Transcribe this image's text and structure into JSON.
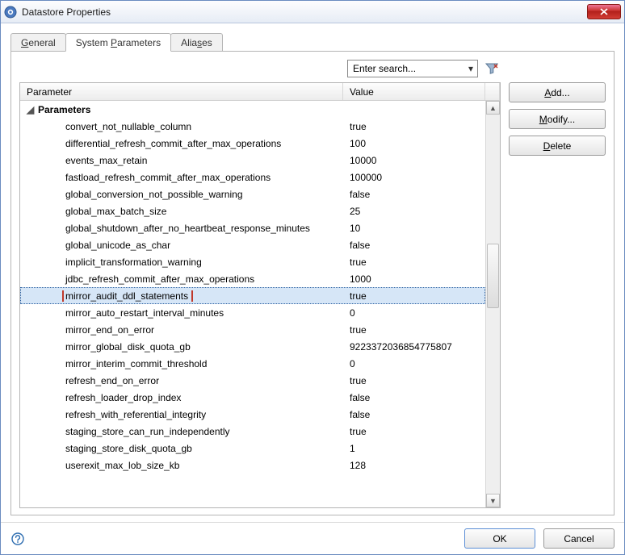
{
  "window": {
    "title": "Datastore Properties"
  },
  "tabs": [
    {
      "label_pre": "",
      "m": "G",
      "label_post": "eneral"
    },
    {
      "label_pre": "System ",
      "m": "P",
      "label_post": "arameters"
    },
    {
      "label_pre": "Alia",
      "m": "s",
      "label_post": "es"
    }
  ],
  "search": {
    "placeholder": "Enter search..."
  },
  "columns": {
    "param": "Parameter",
    "value": "Value"
  },
  "group": {
    "label": "Parameters",
    "glyph": "◢"
  },
  "rows": [
    {
      "name": "convert_not_nullable_column",
      "value": "true"
    },
    {
      "name": "differential_refresh_commit_after_max_operations",
      "value": "100"
    },
    {
      "name": "events_max_retain",
      "value": "10000"
    },
    {
      "name": "fastload_refresh_commit_after_max_operations",
      "value": "100000"
    },
    {
      "name": "global_conversion_not_possible_warning",
      "value": "false"
    },
    {
      "name": "global_max_batch_size",
      "value": "25"
    },
    {
      "name": "global_shutdown_after_no_heartbeat_response_minutes",
      "value": "10"
    },
    {
      "name": "global_unicode_as_char",
      "value": "false"
    },
    {
      "name": "implicit_transformation_warning",
      "value": "true"
    },
    {
      "name": "jdbc_refresh_commit_after_max_operations",
      "value": "1000"
    },
    {
      "name": "mirror_audit_ddl_statements",
      "value": "true",
      "selected": true
    },
    {
      "name": "mirror_auto_restart_interval_minutes",
      "value": "0"
    },
    {
      "name": "mirror_end_on_error",
      "value": "true"
    },
    {
      "name": "mirror_global_disk_quota_gb",
      "value": "9223372036854775807"
    },
    {
      "name": "mirror_interim_commit_threshold",
      "value": "0"
    },
    {
      "name": "refresh_end_on_error",
      "value": "true"
    },
    {
      "name": "refresh_loader_drop_index",
      "value": "false"
    },
    {
      "name": "refresh_with_referential_integrity",
      "value": "false"
    },
    {
      "name": "staging_store_can_run_independently",
      "value": "true"
    },
    {
      "name": "staging_store_disk_quota_gb",
      "value": "1"
    },
    {
      "name": "userexit_max_lob_size_kb",
      "value": "128"
    }
  ],
  "buttons": {
    "add_pre": "",
    "add_m": "A",
    "add_post": "dd...",
    "modify_pre": "",
    "modify_m": "M",
    "modify_post": "odify...",
    "delete_pre": "",
    "delete_m": "D",
    "delete_post": "elete",
    "ok": "OK",
    "cancel": "Cancel"
  }
}
